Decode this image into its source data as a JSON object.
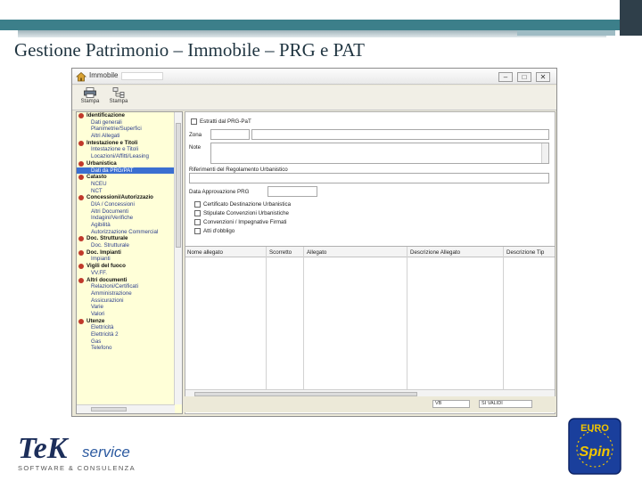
{
  "slide": {
    "title": "Gestione Patrimonio – Immobile – PRG e PAT"
  },
  "window": {
    "title": "Immobile",
    "controls": {
      "minimize": "–",
      "maximize": "□",
      "close": "✕"
    }
  },
  "toolbar": {
    "buttons": [
      {
        "label": "Stampa",
        "icon": "printer-icon"
      },
      {
        "label": "Stampa",
        "icon": "report-icon"
      }
    ]
  },
  "tree": {
    "rows": [
      {
        "text": "Identificazione",
        "kind": "cat"
      },
      {
        "text": "Dati generali",
        "kind": "item"
      },
      {
        "text": "Planimetrie/Superfici",
        "kind": "item"
      },
      {
        "text": "Altri Allegati",
        "kind": "item"
      },
      {
        "text": "Intestazione e Titoli",
        "kind": "cat"
      },
      {
        "text": "Intestazione e Titoli",
        "kind": "item"
      },
      {
        "text": "Locazioni/Affitti/Leasing",
        "kind": "item"
      },
      {
        "text": "Urbanistica",
        "kind": "cat"
      },
      {
        "text": "Dati da PRG/PAT",
        "kind": "item",
        "selected": true
      },
      {
        "text": "Catasto",
        "kind": "cat"
      },
      {
        "text": "NCEU",
        "kind": "item"
      },
      {
        "text": "NCT",
        "kind": "item"
      },
      {
        "text": "Concessioni/Autorizzazio",
        "kind": "cat"
      },
      {
        "text": "DIA / Concessioni",
        "kind": "item"
      },
      {
        "text": "Altri Documenti",
        "kind": "item"
      },
      {
        "text": "Indagini/Verifiche",
        "kind": "item"
      },
      {
        "text": "Agibilità",
        "kind": "item"
      },
      {
        "text": "Autorizzazione Commercial",
        "kind": "item"
      },
      {
        "text": "Doc. Strutturale",
        "kind": "cat"
      },
      {
        "text": "Doc. Strutturale",
        "kind": "item"
      },
      {
        "text": "Doc. Impianti",
        "kind": "cat"
      },
      {
        "text": "Impianti",
        "kind": "item"
      },
      {
        "text": "Vigili del fuoco",
        "kind": "cat"
      },
      {
        "text": "VV.FF.",
        "kind": "item"
      },
      {
        "text": "Altri documenti",
        "kind": "cat"
      },
      {
        "text": "Relazioni/Certificati",
        "kind": "item"
      },
      {
        "text": "Amministrazione",
        "kind": "item"
      },
      {
        "text": "Assicurazioni",
        "kind": "item"
      },
      {
        "text": "Varie",
        "kind": "item"
      },
      {
        "text": "Valori",
        "kind": "item"
      },
      {
        "text": "Utenze",
        "kind": "cat"
      },
      {
        "text": "Elettricità",
        "kind": "item"
      },
      {
        "text": "Elettricità 2",
        "kind": "item"
      },
      {
        "text": "Gas",
        "kind": "item"
      },
      {
        "text": "Telefono",
        "kind": "item"
      }
    ]
  },
  "form": {
    "prg_checkbox_label": "Estratti dal PRG-PaT",
    "zona_label": "Zona",
    "note_label": "Note",
    "riferimenti_label": "Riferimenti del Regolamento Urbanistico",
    "data_label": "Data Approvazione PRG",
    "checkboxes": [
      "Certificato Destinazione Urbanistica",
      "Stipulate Convenzioni Urbanistiche",
      "Convenzioni / Impegnative Firmati",
      "Atti d'obbligo"
    ],
    "grid_columns": [
      "Nome allegato",
      "Scorretto",
      "Allegato",
      "Descrizione Allegato",
      "Descrizione Tip"
    ]
  },
  "status": {
    "field1": "VB",
    "field2": "SI VALIDI"
  },
  "logos": {
    "tek_main": "TeK",
    "tek_service": "service",
    "tek_tagline": "SOFTWARE & CONSULENZA",
    "euro_top": "EURO",
    "euro_bottom": "Spin"
  },
  "colors": {
    "teal": "#3c7f8a",
    "tree_bg": "#ffffd8",
    "selection": "#3b6fd1",
    "category_icon": "#c0392b",
    "euro_blue": "#1a3f9c",
    "euro_yellow": "#f2c500"
  }
}
